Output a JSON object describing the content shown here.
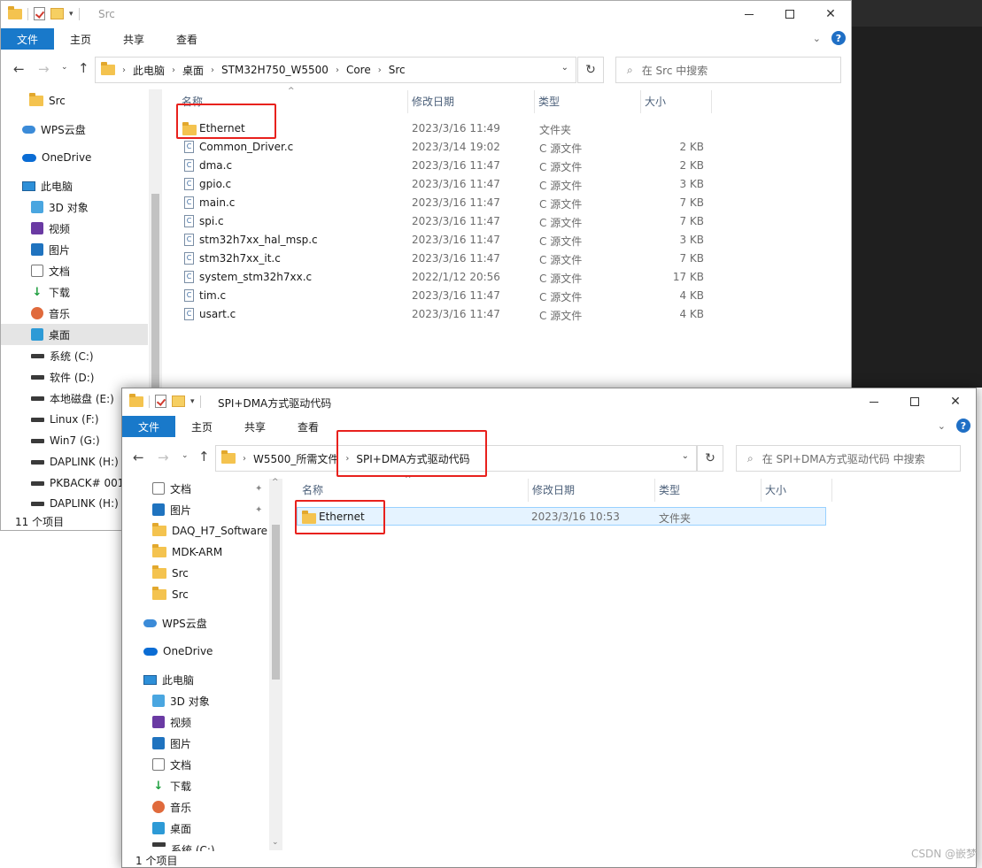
{
  "window1": {
    "title": "Src",
    "ribbon_tabs": [
      "文件",
      "主页",
      "共享",
      "查看"
    ],
    "breadcrumb": [
      "此电脑",
      "桌面",
      "STM32H750_W5500",
      "Core",
      "Src"
    ],
    "search_placeholder": "在 Src 中搜索",
    "nav_items": [
      {
        "label": "Src",
        "icon": "folder-icon"
      },
      {
        "label": "WPS云盘",
        "icon": "cloud-icon"
      },
      {
        "label": "OneDrive",
        "icon": "onedrive-icon"
      },
      {
        "label": "此电脑",
        "icon": "computer-icon"
      },
      {
        "label": "3D 对象",
        "icon": "cube-icon"
      },
      {
        "label": "视频",
        "icon": "video-icon"
      },
      {
        "label": "图片",
        "icon": "picture-icon"
      },
      {
        "label": "文档",
        "icon": "document-icon"
      },
      {
        "label": "下载",
        "icon": "download-icon"
      },
      {
        "label": "音乐",
        "icon": "music-icon"
      },
      {
        "label": "桌面",
        "icon": "desktop-icon"
      },
      {
        "label": "系统 (C:)",
        "icon": "drive-icon"
      },
      {
        "label": "软件 (D:)",
        "icon": "drive-icon"
      },
      {
        "label": "本地磁盘 (E:)",
        "icon": "drive-icon"
      },
      {
        "label": "Linux (F:)",
        "icon": "drive-icon"
      },
      {
        "label": "Win7 (G:)",
        "icon": "drive-icon"
      },
      {
        "label": "DAPLINK (H:)",
        "icon": "drive-icon"
      },
      {
        "label": "PKBACK# 001",
        "icon": "drive-icon"
      },
      {
        "label": "DAPLINK (H:)",
        "icon": "drive-icon"
      }
    ],
    "columns": [
      "名称",
      "修改日期",
      "类型",
      "大小"
    ],
    "files": [
      {
        "name": "Ethernet",
        "date": "2023/3/16 11:49",
        "type": "文件夹",
        "size": "",
        "kind": "folder"
      },
      {
        "name": "Common_Driver.c",
        "date": "2023/3/14 19:02",
        "type": "C 源文件",
        "size": "2 KB",
        "kind": "c"
      },
      {
        "name": "dma.c",
        "date": "2023/3/16 11:47",
        "type": "C 源文件",
        "size": "2 KB",
        "kind": "c"
      },
      {
        "name": "gpio.c",
        "date": "2023/3/16 11:47",
        "type": "C 源文件",
        "size": "3 KB",
        "kind": "c"
      },
      {
        "name": "main.c",
        "date": "2023/3/16 11:47",
        "type": "C 源文件",
        "size": "7 KB",
        "kind": "c"
      },
      {
        "name": "spi.c",
        "date": "2023/3/16 11:47",
        "type": "C 源文件",
        "size": "7 KB",
        "kind": "c"
      },
      {
        "name": "stm32h7xx_hal_msp.c",
        "date": "2023/3/16 11:47",
        "type": "C 源文件",
        "size": "3 KB",
        "kind": "c"
      },
      {
        "name": "stm32h7xx_it.c",
        "date": "2023/3/16 11:47",
        "type": "C 源文件",
        "size": "7 KB",
        "kind": "c"
      },
      {
        "name": "system_stm32h7xx.c",
        "date": "2022/1/12 20:56",
        "type": "C 源文件",
        "size": "17 KB",
        "kind": "c"
      },
      {
        "name": "tim.c",
        "date": "2023/3/16 11:47",
        "type": "C 源文件",
        "size": "4 KB",
        "kind": "c"
      },
      {
        "name": "usart.c",
        "date": "2023/3/16 11:47",
        "type": "C 源文件",
        "size": "4 KB",
        "kind": "c"
      }
    ],
    "status": "11 个项目"
  },
  "window2": {
    "title": "SPI+DMA方式驱动代码",
    "ribbon_tabs": [
      "文件",
      "主页",
      "共享",
      "查看"
    ],
    "breadcrumb": [
      "W5500_所需文件",
      "SPI+DMA方式驱动代码"
    ],
    "search_placeholder": "在 SPI+DMA方式驱动代码 中搜索",
    "nav_items": [
      {
        "label": "文档",
        "icon": "document-icon",
        "pinned": true
      },
      {
        "label": "图片",
        "icon": "picture-icon",
        "pinned": true
      },
      {
        "label": "DAQ_H7_Software",
        "icon": "folder-icon"
      },
      {
        "label": "MDK-ARM",
        "icon": "folder-icon"
      },
      {
        "label": "Src",
        "icon": "folder-icon"
      },
      {
        "label": "Src",
        "icon": "folder-icon"
      },
      {
        "label": "WPS云盘",
        "icon": "cloud-icon"
      },
      {
        "label": "OneDrive",
        "icon": "onedrive-icon"
      },
      {
        "label": "此电脑",
        "icon": "computer-icon"
      },
      {
        "label": "3D 对象",
        "icon": "cube-icon"
      },
      {
        "label": "视频",
        "icon": "video-icon"
      },
      {
        "label": "图片",
        "icon": "picture-icon"
      },
      {
        "label": "文档",
        "icon": "document-icon"
      },
      {
        "label": "下载",
        "icon": "download-icon"
      },
      {
        "label": "音乐",
        "icon": "music-icon"
      },
      {
        "label": "桌面",
        "icon": "desktop-icon"
      },
      {
        "label": "系统 (C:)",
        "icon": "drive-icon"
      }
    ],
    "columns": [
      "名称",
      "修改日期",
      "类型",
      "大小"
    ],
    "files": [
      {
        "name": "Ethernet",
        "date": "2023/3/16 10:53",
        "type": "文件夹",
        "size": "",
        "kind": "folder"
      }
    ],
    "status": "1 个项目"
  },
  "watermark": "CSDN @嵌梦",
  "colors": {
    "file_tab": "#1979ca",
    "highlight": "#e8211d",
    "selection": "#cce8ff"
  }
}
